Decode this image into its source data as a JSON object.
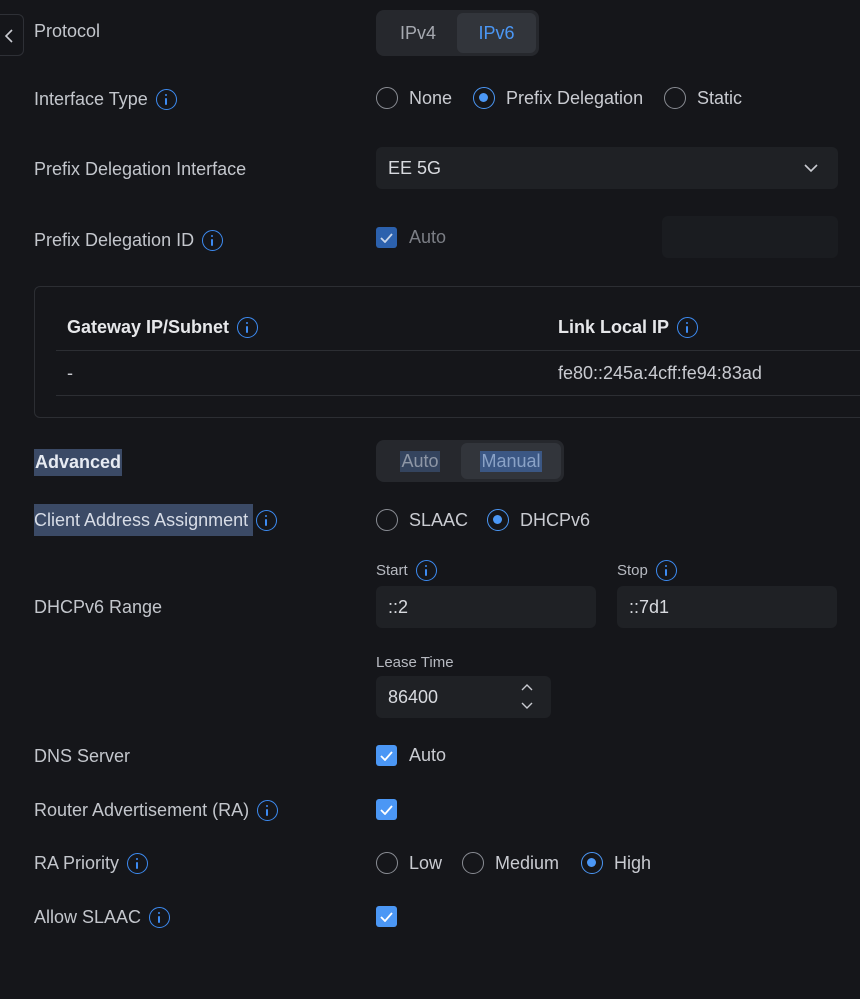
{
  "protocol": {
    "label": "Protocol",
    "options": [
      "IPv4",
      "IPv6"
    ],
    "selected": "IPv6"
  },
  "interface_type": {
    "label": "Interface Type",
    "options": [
      "None",
      "Prefix Delegation",
      "Static"
    ],
    "selected": "Prefix Delegation"
  },
  "pd_interface": {
    "label": "Prefix Delegation Interface",
    "value": "EE 5G"
  },
  "pd_id": {
    "label": "Prefix Delegation ID",
    "auto_label": "Auto",
    "checked": true,
    "value": ""
  },
  "table": {
    "headers": [
      "Gateway IP/Subnet",
      "Link Local IP"
    ],
    "rows": [
      [
        "-",
        "fe80::245a:4cff:fe94:83ad"
      ]
    ]
  },
  "advanced": {
    "label": "Advanced",
    "options": [
      "Auto",
      "Manual"
    ],
    "selected": "Manual"
  },
  "client_assignment": {
    "label": "Client Address Assignment",
    "options": [
      "SLAAC",
      "DHCPv6"
    ],
    "selected": "DHCPv6"
  },
  "dhcp_range": {
    "label": "DHCPv6 Range",
    "start_label": "Start",
    "start_value": "::2",
    "stop_label": "Stop",
    "stop_value": "::7d1"
  },
  "lease": {
    "label": "Lease Time",
    "value": "86400"
  },
  "dns": {
    "label": "DNS Server",
    "auto_label": "Auto",
    "checked": true
  },
  "ra": {
    "label": "Router Advertisement (RA)",
    "checked": true
  },
  "ra_priority": {
    "label": "RA Priority",
    "options": [
      "Low",
      "Medium",
      "High"
    ],
    "selected": "High"
  },
  "allow_slaac": {
    "label": "Allow SLAAC",
    "checked": true
  },
  "colors": {
    "background": "#15161a",
    "accent": "#4b97f5",
    "field": "#1f2125"
  }
}
